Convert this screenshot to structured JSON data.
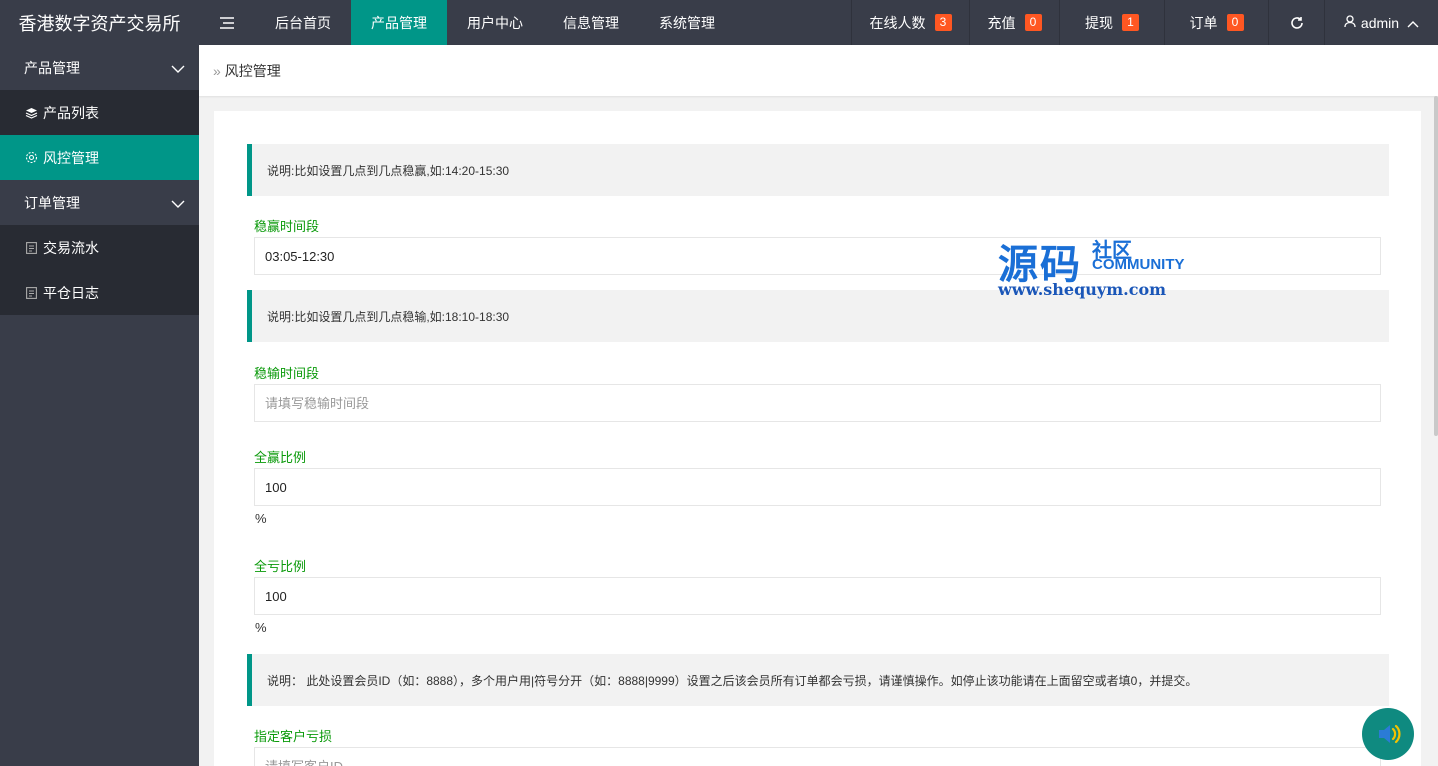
{
  "app": {
    "title": "香港数字资产交易所"
  },
  "topnav": [
    {
      "label": "后台首页",
      "active": false
    },
    {
      "label": "产品管理",
      "active": true
    },
    {
      "label": "用户中心",
      "active": false
    },
    {
      "label": "信息管理",
      "active": false
    },
    {
      "label": "系统管理",
      "active": false
    }
  ],
  "right_nav": {
    "online": {
      "label": "在线人数",
      "count": "3"
    },
    "recharge": {
      "label": "充值",
      "count": "0"
    },
    "withdraw": {
      "label": "提现",
      "count": "1"
    },
    "orders": {
      "label": "订单",
      "count": "0"
    },
    "user": {
      "label": "admin"
    }
  },
  "sidebar": {
    "groups": [
      {
        "label": "产品管理",
        "children": [
          {
            "label": "产品列表",
            "icon": "layers-icon",
            "active": false
          },
          {
            "label": "风控管理",
            "icon": "gear-icon",
            "active": true
          }
        ]
      },
      {
        "label": "订单管理",
        "children": [
          {
            "label": "交易流水",
            "icon": "clipboard-icon",
            "active": false
          },
          {
            "label": "平仓日志",
            "icon": "clipboard-icon",
            "active": false
          }
        ]
      }
    ]
  },
  "breadcrumb": {
    "current": "风控管理"
  },
  "form": {
    "notice1": "说明:比如设置几点到几点稳赢,如:14:20-15:30",
    "win_period": {
      "label": "稳赢时间段",
      "value": "03:05-12:30"
    },
    "notice2": "说明:比如设置几点到几点稳输,如:18:10-18:30",
    "lose_period": {
      "label": "稳输时间段",
      "placeholder": "请填写稳输时间段"
    },
    "full_win": {
      "label": "全赢比例",
      "value": "100",
      "unit": "%"
    },
    "full_loss": {
      "label": "全亏比例",
      "value": "100",
      "unit": "%"
    },
    "notice3": "说明： 此处设置会员ID（如：8888），多个用户用|符号分开（如：8888|9999）设置之后该会员所有订单都会亏损，请谨慎操作。如停止该功能请在上面留空或者填0，并提交。",
    "loss_customer": {
      "label": "指定客户亏损",
      "placeholder": "请填写客户ID"
    }
  },
  "watermark": {
    "cn": "源码",
    "cn_small": "社区",
    "en": "COMMUNITY",
    "url": "www.shequym.com"
  },
  "colors": {
    "header": "#393d49",
    "accent": "#009688",
    "badge": "#ff5722",
    "label_green": "#0a9a0a"
  }
}
